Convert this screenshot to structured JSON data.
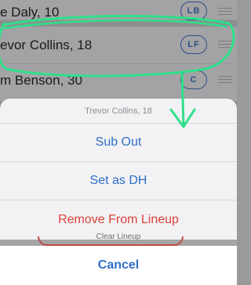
{
  "lineup": {
    "rows": [
      {
        "name": "e Daly, 10",
        "position": "LB"
      },
      {
        "name": "evor Collins, 18",
        "position": "LF"
      },
      {
        "name": "m Benson, 30",
        "position": "C"
      }
    ]
  },
  "action_sheet": {
    "title": "Trevor Collins, 18",
    "actions": [
      {
        "label": "Sub Out"
      },
      {
        "label": "Set as DH"
      },
      {
        "label": "Remove From Lineup"
      }
    ],
    "background_button_peek": "Clear Lineup",
    "cancel_label": "Cancel"
  },
  "colors": {
    "accent": "#2f6fc6",
    "destructive": "#e0403a",
    "annotation": "#2ee08a"
  }
}
